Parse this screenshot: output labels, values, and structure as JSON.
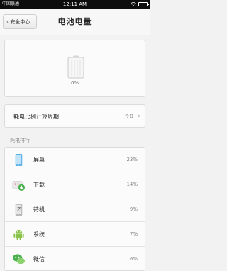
{
  "status_bar": {
    "carrier": "中国联通",
    "time": "12:11 AM"
  },
  "header": {
    "back_label": "安全中心",
    "title": "电池电量"
  },
  "battery": {
    "percent_text": "0%",
    "level_fraction": 0.0
  },
  "period": {
    "label": "耗电比例计算周期",
    "value": "今日"
  },
  "ranking": {
    "section_title": "耗电排行",
    "items": [
      {
        "name": "屏幕",
        "percent": "23%",
        "icon": "screen-icon"
      },
      {
        "name": "下载",
        "percent": "14%",
        "icon": "download-icon"
      },
      {
        "name": "待机",
        "percent": "9%",
        "icon": "standby-icon"
      },
      {
        "name": "系统",
        "percent": "7%",
        "icon": "android-icon"
      },
      {
        "name": "微信",
        "percent": "6%",
        "icon": "wechat-icon"
      }
    ]
  },
  "colors": {
    "low_battery": "#ff3b30",
    "android_green": "#8bc34a",
    "wechat_green": "#4caf50",
    "screen_blue": "#59aee6"
  }
}
